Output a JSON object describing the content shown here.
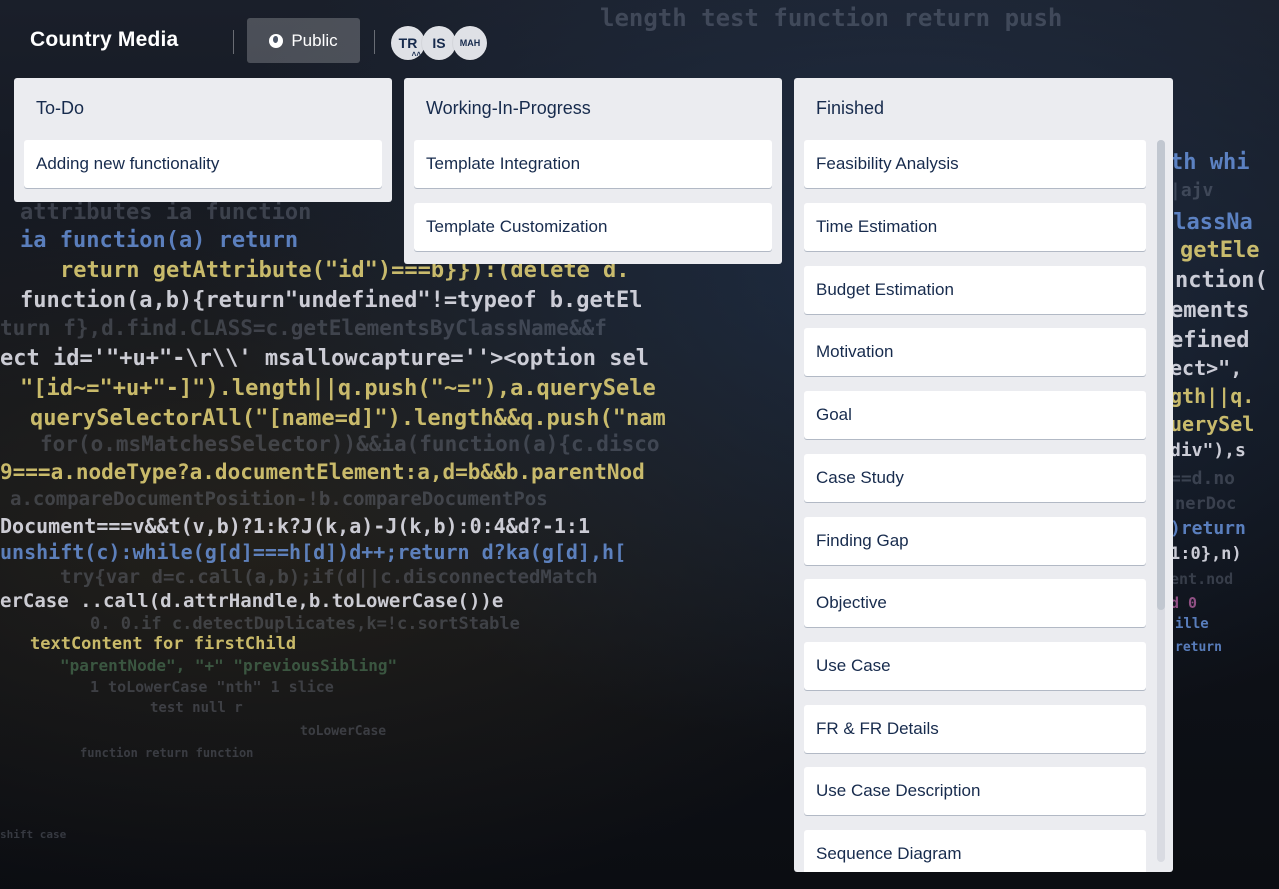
{
  "board": {
    "title": "Country Media",
    "visibility_label": "Public",
    "members": [
      {
        "initials": "TR",
        "is_admin": true
      },
      {
        "initials": "IS",
        "is_admin": false
      },
      {
        "initials": "MAH",
        "is_admin": false
      }
    ]
  },
  "lists": [
    {
      "title": "To-Do",
      "cards": [
        "Adding new functionality"
      ]
    },
    {
      "title": "Working-In-Progress",
      "cards": [
        "Template Integration",
        "Template Customization"
      ]
    },
    {
      "title": "Finished",
      "cards": [
        "Feasibility Analysis",
        "Time Estimation",
        "Budget Estimation",
        "Motivation",
        "Goal",
        "Case Study",
        "Finding Gap",
        "Objective",
        "Use Case",
        "FR & FR Details",
        "Use Case Description",
        "Sequence Diagram"
      ]
    }
  ],
  "icons": {
    "visibility": "globe-icon",
    "admin_badge": "chevron-up-icon"
  },
  "colors": {
    "list_bg": "#ebecf0",
    "card_bg": "#ffffff",
    "text": "#172b4d",
    "header_button_bg": "rgba(255,255,255,0.22)"
  }
}
